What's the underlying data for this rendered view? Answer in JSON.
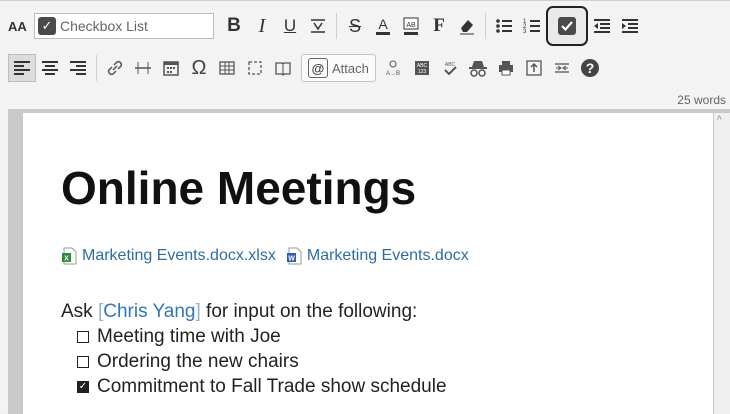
{
  "toolbar": {
    "font_size_label": "AA",
    "style_select": {
      "value": "Checkbox List",
      "icon": "checkbox-icon"
    },
    "attach_label": "Attach",
    "word_count": "25 words"
  },
  "document": {
    "title": "Online Meetings",
    "attachments": [
      {
        "name": "Marketing Events.docx.xlsx",
        "icon": "excel-file-icon"
      },
      {
        "name": "Marketing Events.docx",
        "icon": "word-file-icon"
      }
    ],
    "intro_prefix": "Ask ",
    "mention": "Chris Yang",
    "intro_suffix": " for input on the following:",
    "checklist": [
      {
        "text": "Meeting time with Joe",
        "checked": false
      },
      {
        "text": "Ordering the new chairs",
        "checked": false
      },
      {
        "text": "Commitment to Fall Trade show schedule",
        "checked": true
      }
    ]
  },
  "colors": {
    "link": "#2e6da4",
    "mention": "#2e79b9",
    "toolbar_bg": "#f3f3f3"
  }
}
